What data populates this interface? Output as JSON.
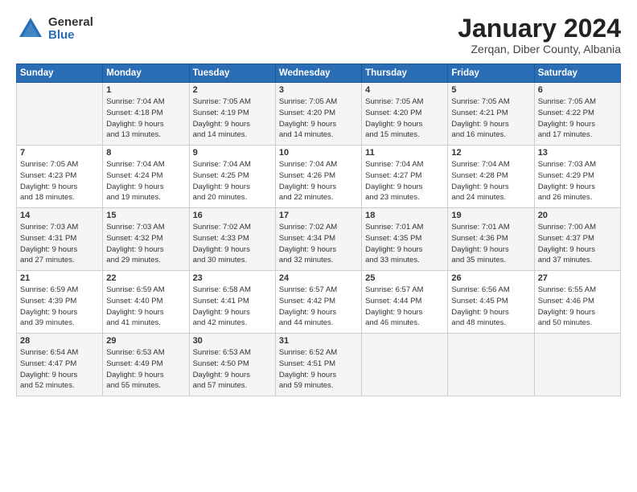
{
  "header": {
    "logo_general": "General",
    "logo_blue": "Blue",
    "month_title": "January 2024",
    "subtitle": "Zerqan, Diber County, Albania"
  },
  "days_of_week": [
    "Sunday",
    "Monday",
    "Tuesday",
    "Wednesday",
    "Thursday",
    "Friday",
    "Saturday"
  ],
  "weeks": [
    [
      {
        "day": "",
        "info": ""
      },
      {
        "day": "1",
        "info": "Sunrise: 7:04 AM\nSunset: 4:18 PM\nDaylight: 9 hours\nand 13 minutes."
      },
      {
        "day": "2",
        "info": "Sunrise: 7:05 AM\nSunset: 4:19 PM\nDaylight: 9 hours\nand 14 minutes."
      },
      {
        "day": "3",
        "info": "Sunrise: 7:05 AM\nSunset: 4:20 PM\nDaylight: 9 hours\nand 14 minutes."
      },
      {
        "day": "4",
        "info": "Sunrise: 7:05 AM\nSunset: 4:20 PM\nDaylight: 9 hours\nand 15 minutes."
      },
      {
        "day": "5",
        "info": "Sunrise: 7:05 AM\nSunset: 4:21 PM\nDaylight: 9 hours\nand 16 minutes."
      },
      {
        "day": "6",
        "info": "Sunrise: 7:05 AM\nSunset: 4:22 PM\nDaylight: 9 hours\nand 17 minutes."
      }
    ],
    [
      {
        "day": "7",
        "info": "Sunrise: 7:05 AM\nSunset: 4:23 PM\nDaylight: 9 hours\nand 18 minutes."
      },
      {
        "day": "8",
        "info": "Sunrise: 7:04 AM\nSunset: 4:24 PM\nDaylight: 9 hours\nand 19 minutes."
      },
      {
        "day": "9",
        "info": "Sunrise: 7:04 AM\nSunset: 4:25 PM\nDaylight: 9 hours\nand 20 minutes."
      },
      {
        "day": "10",
        "info": "Sunrise: 7:04 AM\nSunset: 4:26 PM\nDaylight: 9 hours\nand 22 minutes."
      },
      {
        "day": "11",
        "info": "Sunrise: 7:04 AM\nSunset: 4:27 PM\nDaylight: 9 hours\nand 23 minutes."
      },
      {
        "day": "12",
        "info": "Sunrise: 7:04 AM\nSunset: 4:28 PM\nDaylight: 9 hours\nand 24 minutes."
      },
      {
        "day": "13",
        "info": "Sunrise: 7:03 AM\nSunset: 4:29 PM\nDaylight: 9 hours\nand 26 minutes."
      }
    ],
    [
      {
        "day": "14",
        "info": "Sunrise: 7:03 AM\nSunset: 4:31 PM\nDaylight: 9 hours\nand 27 minutes."
      },
      {
        "day": "15",
        "info": "Sunrise: 7:03 AM\nSunset: 4:32 PM\nDaylight: 9 hours\nand 29 minutes."
      },
      {
        "day": "16",
        "info": "Sunrise: 7:02 AM\nSunset: 4:33 PM\nDaylight: 9 hours\nand 30 minutes."
      },
      {
        "day": "17",
        "info": "Sunrise: 7:02 AM\nSunset: 4:34 PM\nDaylight: 9 hours\nand 32 minutes."
      },
      {
        "day": "18",
        "info": "Sunrise: 7:01 AM\nSunset: 4:35 PM\nDaylight: 9 hours\nand 33 minutes."
      },
      {
        "day": "19",
        "info": "Sunrise: 7:01 AM\nSunset: 4:36 PM\nDaylight: 9 hours\nand 35 minutes."
      },
      {
        "day": "20",
        "info": "Sunrise: 7:00 AM\nSunset: 4:37 PM\nDaylight: 9 hours\nand 37 minutes."
      }
    ],
    [
      {
        "day": "21",
        "info": "Sunrise: 6:59 AM\nSunset: 4:39 PM\nDaylight: 9 hours\nand 39 minutes."
      },
      {
        "day": "22",
        "info": "Sunrise: 6:59 AM\nSunset: 4:40 PM\nDaylight: 9 hours\nand 41 minutes."
      },
      {
        "day": "23",
        "info": "Sunrise: 6:58 AM\nSunset: 4:41 PM\nDaylight: 9 hours\nand 42 minutes."
      },
      {
        "day": "24",
        "info": "Sunrise: 6:57 AM\nSunset: 4:42 PM\nDaylight: 9 hours\nand 44 minutes."
      },
      {
        "day": "25",
        "info": "Sunrise: 6:57 AM\nSunset: 4:44 PM\nDaylight: 9 hours\nand 46 minutes."
      },
      {
        "day": "26",
        "info": "Sunrise: 6:56 AM\nSunset: 4:45 PM\nDaylight: 9 hours\nand 48 minutes."
      },
      {
        "day": "27",
        "info": "Sunrise: 6:55 AM\nSunset: 4:46 PM\nDaylight: 9 hours\nand 50 minutes."
      }
    ],
    [
      {
        "day": "28",
        "info": "Sunrise: 6:54 AM\nSunset: 4:47 PM\nDaylight: 9 hours\nand 52 minutes."
      },
      {
        "day": "29",
        "info": "Sunrise: 6:53 AM\nSunset: 4:49 PM\nDaylight: 9 hours\nand 55 minutes."
      },
      {
        "day": "30",
        "info": "Sunrise: 6:53 AM\nSunset: 4:50 PM\nDaylight: 9 hours\nand 57 minutes."
      },
      {
        "day": "31",
        "info": "Sunrise: 6:52 AM\nSunset: 4:51 PM\nDaylight: 9 hours\nand 59 minutes."
      },
      {
        "day": "",
        "info": ""
      },
      {
        "day": "",
        "info": ""
      },
      {
        "day": "",
        "info": ""
      }
    ]
  ]
}
